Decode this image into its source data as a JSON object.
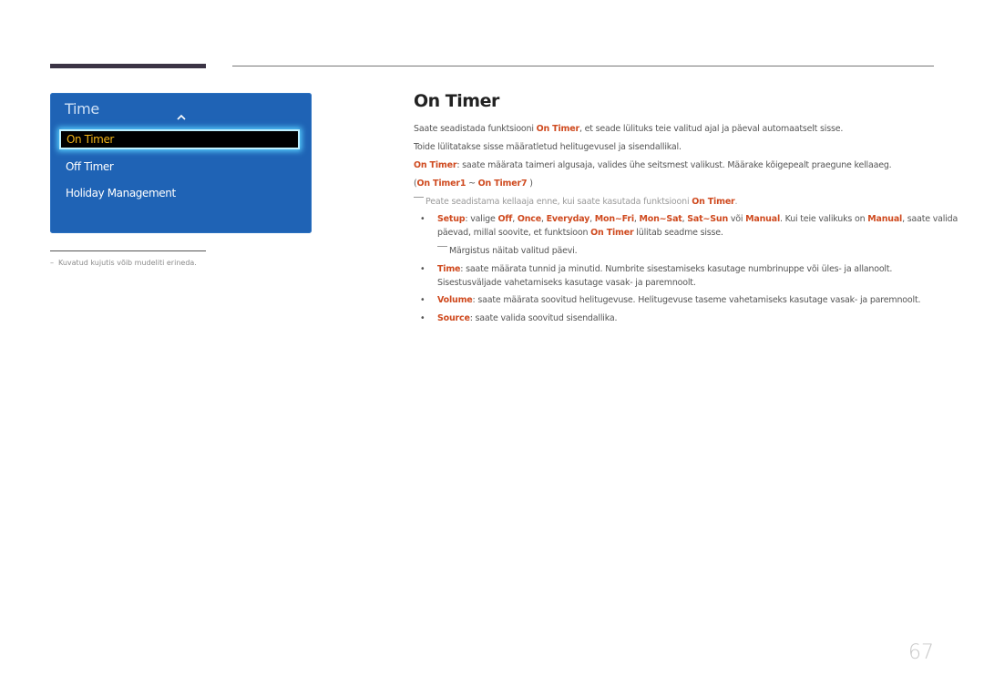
{
  "sidebar": {
    "menu_title": "Time",
    "chevron_icon": "chevron-up-icon",
    "items": [
      {
        "label": "On Timer",
        "selected": true
      },
      {
        "label": "Off Timer",
        "selected": false
      },
      {
        "label": "Holiday Management",
        "selected": false
      }
    ],
    "note": "Kuvatud kujutis võib mudeliti erineda.",
    "note_dash": "–"
  },
  "main": {
    "title": "On Timer",
    "intro": {
      "pre": "Saate seadistada funktsiooni ",
      "hl": "On Timer",
      "post": ", et seade lülituks teie valitud ajal ja päeval automaatselt sisse."
    },
    "power_line": "Toide lülitatakse sisse määratletud helitugevusel ja sisendallikal.",
    "on_timer_desc": {
      "hl": "On Timer",
      "post": ": saate määrata taimeri algusaja, valides ühe seitsmest valikust. Määrake kõigepealt praegune kellaaeg."
    },
    "range": {
      "open": "(",
      "from": "On Timer1",
      "sep": " ~ ",
      "to": "On Timer7",
      "close": " )"
    },
    "note1": {
      "pre": "Peate seadistama kellaaja enne, kui saate kasutada funktsiooni ",
      "hl": "On Timer",
      "post": "."
    },
    "bullets": {
      "setup": {
        "label": "Setup",
        "t1": ": valige ",
        "o1": "Off",
        "c1": ", ",
        "o2": "Once",
        "c2": ", ",
        "o3": "Everyday",
        "c3": ", ",
        "o4": "Mon~Fri",
        "c4": ", ",
        "o5": "Mon~Sat",
        "c5": ", ",
        "o6": "Sat~Sun",
        "t2": " või ",
        "o7": "Manual",
        "t3": ". Kui teie valikuks on ",
        "o8": "Manual",
        "t4": ", saate valida",
        "line2_pre": "päevad, millal soovite, et funktsioon ",
        "line2_hl": "On Timer",
        "line2_post": " lülitab seadme sisse.",
        "note": "Märgistus näitab valitud päevi."
      },
      "time": {
        "label": "Time",
        "line1": ": saate määrata tunnid ja minutid. Numbrite sisestamiseks kasutage numbrinuppe või üles- ja allanoolt.",
        "line2": "Sisestusväljade vahetamiseks kasutage vasak- ja paremnoolt."
      },
      "volume": {
        "label": "Volume",
        "text": ": saate määrata soovitud helitugevuse. Helitugevuse taseme vahetamiseks kasutage vasak- ja paremnoolt."
      },
      "source": {
        "label": "Source",
        "text": ": saate valida soovitud sisendallika."
      }
    },
    "bullet_char": "•"
  },
  "footer": {
    "page_number": "67"
  },
  "colors": {
    "accent": "#cf4a1f",
    "menu_bg": "#1f63b5",
    "selected_text": "#f2b418"
  }
}
